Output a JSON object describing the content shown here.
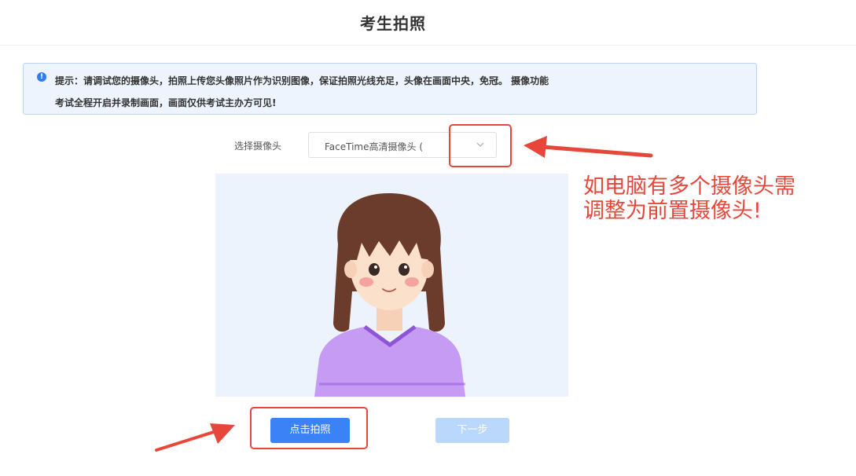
{
  "page": {
    "title": "考生拍照"
  },
  "notice": {
    "icon": "info-icon",
    "line1": "提示：请调试您的摄像头，拍照上传您头像照片作为识别图像，保证拍照光线充足，头像在画面中央，免冠。 摄像功能",
    "line2": "考试全程开启并录制画面，画面仅供考试主办方可见!"
  },
  "camera": {
    "label": "选择摄像头",
    "selected": "FaceTime高清摄像头 (",
    "dropdown_icon": "chevron-down-icon"
  },
  "annotation": {
    "line1": "如电脑有多个摄像头需",
    "line2": "调整为前置摄像头!"
  },
  "preview": {
    "illustration": "avatar-placeholder-girl"
  },
  "buttons": {
    "capture": "点击拍照",
    "next": "下一步"
  },
  "colors": {
    "primary": "#3b82f6",
    "primary_disabled": "#b9d8fb",
    "annotation_red": "#e7473a",
    "notice_bg": "#eef4fd",
    "notice_border": "#b9d3f5"
  }
}
